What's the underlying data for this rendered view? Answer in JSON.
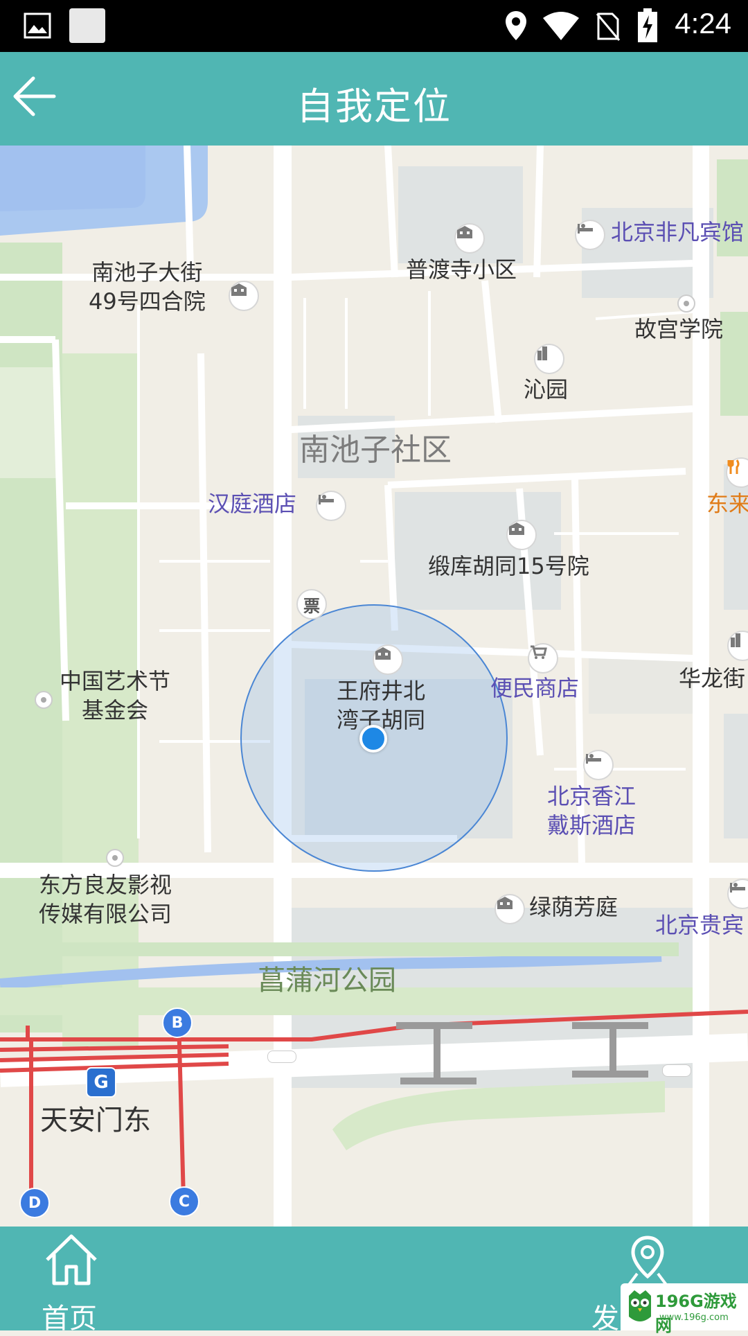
{
  "status_bar": {
    "time": "4:24",
    "icons": [
      "image-icon",
      "notification-icon",
      "location-icon",
      "wifi-icon",
      "no-sim-icon",
      "battery-charging-icon"
    ]
  },
  "app_bar": {
    "title": "自我定位",
    "back_icon": "arrow-left-icon"
  },
  "map": {
    "pois": [
      {
        "id": "nanchizi-49",
        "line1": "南池子大街",
        "line2": "49号四合院",
        "icon": "building-icon"
      },
      {
        "id": "pudusi",
        "label": "普渡寺小区",
        "icon": "building-icon"
      },
      {
        "id": "feifan",
        "label": "北京非凡宾馆",
        "icon": "hotel-icon"
      },
      {
        "id": "gugong-xueyuan",
        "label": "故宫学院",
        "icon": "dot-icon"
      },
      {
        "id": "qinyuan",
        "label": "沁园",
        "icon": "tower-icon"
      },
      {
        "id": "nanchizi-shequ",
        "label": "南池子社区"
      },
      {
        "id": "hanting",
        "label": "汉庭酒店",
        "icon": "hotel-icon"
      },
      {
        "id": "donglai",
        "label": "东来",
        "icon": "restaurant-icon"
      },
      {
        "id": "duanku",
        "label": "缎库胡同15号院",
        "icon": "building-icon"
      },
      {
        "id": "ticket",
        "icon": "ticket-icon",
        "glyph": "票"
      },
      {
        "id": "yishujie",
        "line1": "中国艺术节",
        "line2": "基金会",
        "icon": "dot-icon"
      },
      {
        "id": "wangfujing",
        "line1": "王府井北",
        "line2": "湾子胡同",
        "icon": "building-icon"
      },
      {
        "id": "bianmin",
        "label": "便民商店",
        "icon": "cart-icon"
      },
      {
        "id": "hualong",
        "label": "华龙街",
        "icon": "tower-icon"
      },
      {
        "id": "xiangjiang",
        "line1": "北京香江",
        "line2": "戴斯酒店",
        "icon": "hotel-icon"
      },
      {
        "id": "dongfang",
        "line1": "东方良友影视",
        "line2": "传媒有限公司",
        "icon": "dot-icon"
      },
      {
        "id": "lvyin",
        "label": "绿荫芳庭",
        "icon": "building-icon"
      },
      {
        "id": "guibin",
        "label": "北京贵宾",
        "icon": "hotel-icon"
      },
      {
        "id": "changpu",
        "label": "菖蒲河公园"
      },
      {
        "id": "tiananmen-dong",
        "label": "天安门东",
        "icon": "metro-icon"
      }
    ],
    "metro_exits": [
      "B",
      "C",
      "D"
    ],
    "my_location_icon": "location-dot-icon",
    "accuracy_circle_icon": "accuracy-circle-icon"
  },
  "bottom_nav": {
    "items": [
      {
        "label": "首页",
        "icon": "home-icon"
      },
      {
        "label": "发",
        "icon": "location-pin-icon"
      }
    ]
  },
  "watermark": {
    "title": "196G游戏网",
    "url": "www.196g.com"
  },
  "colors": {
    "app_bar": "#50b6b3",
    "status_bar": "#000000",
    "map_background": "#f1eee6",
    "poi_purple": "#5b4fb3",
    "poi_orange": "#e07b17",
    "metro_line": "#e04848",
    "location_dot": "#1e88e5"
  }
}
